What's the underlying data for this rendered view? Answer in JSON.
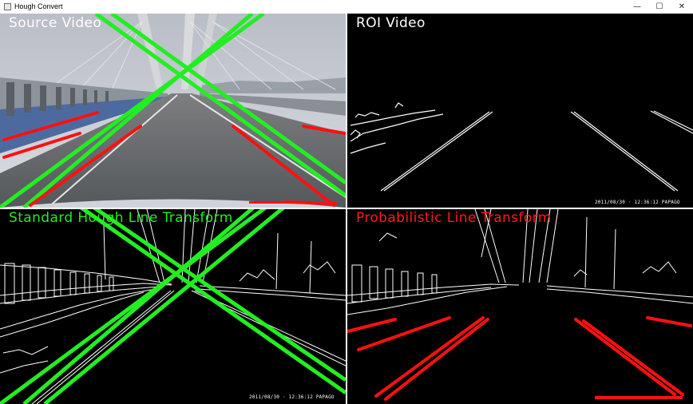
{
  "window": {
    "title": "Hough Convert",
    "controls": {
      "minimize": "—",
      "maximize": "☐",
      "close": "✕"
    }
  },
  "panes": {
    "source": {
      "label": "Source Video",
      "label_color": "#ffffff"
    },
    "roi": {
      "label": "ROI Video",
      "label_color": "#ffffff",
      "timestamp": "2011/08/30 · 12:36:12 PAPAGO"
    },
    "standard": {
      "label": "Standard Hough Line Transform",
      "label_color": "#22ee22",
      "timestamp": "2011/08/30 · 12:36:12 PAPAGO"
    },
    "probabilistic": {
      "label": "Probabilistic Line Transform",
      "label_color": "#ff1a1a"
    }
  },
  "colors": {
    "standard_lines": "#22ee22",
    "probabilistic_lines": "#ff1010",
    "edges": "#ffffff",
    "sky": "#c9ccd2",
    "road": "#6b6d70"
  }
}
